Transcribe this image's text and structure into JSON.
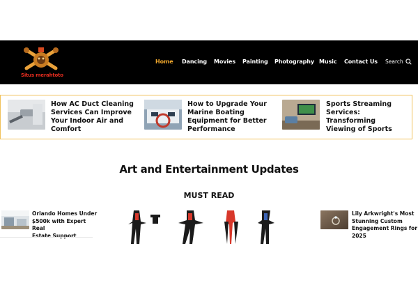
{
  "header": {
    "logo_text": "Situs merahtoto",
    "nav": [
      {
        "label": "Home",
        "active": true
      },
      {
        "label": "Dancing",
        "active": false
      },
      {
        "label": "Movies",
        "active": false
      },
      {
        "label": "Painting",
        "active": false
      },
      {
        "label": "Photography",
        "active": false
      },
      {
        "label": "Music",
        "active": false
      },
      {
        "label": "Contact Us",
        "active": false
      }
    ],
    "search_label": "Search"
  },
  "featured": [
    {
      "title_lines": [
        "How AC Duct Cleaning",
        "Services Can Improve",
        "Your Indoor Air and",
        "Comfort"
      ]
    },
    {
      "title_lines": [
        "How to Upgrade Your",
        "Marine Boating",
        "Equipment for Better",
        "Performance"
      ]
    },
    {
      "title_lines": [
        "Sports Streaming",
        "Services: Transforming",
        "Viewing of Sports"
      ]
    }
  ],
  "section_title": "Art and Entertainment Updates",
  "must_read": "MUST READ",
  "side_left": {
    "title_lines": [
      "Orlando Homes Under",
      "$500k with Expert Real",
      "Estate Support"
    ]
  },
  "side_right": {
    "title_lines": [
      "Lily Arkwright's Most",
      "Stunning Custom",
      "Engagement Rings for",
      "2025"
    ]
  },
  "colors": {
    "accent": "#f0a72c",
    "border": "#f1c15a",
    "header_bg": "#000000",
    "logo_red": "#e62d1f"
  }
}
